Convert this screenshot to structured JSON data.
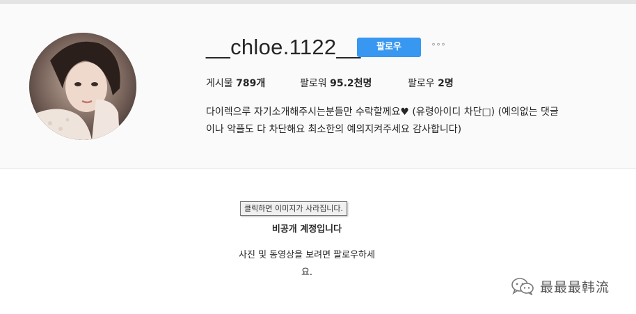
{
  "profile": {
    "username": "__chloe.1122__",
    "follow_label": "팔로우",
    "more_label": "°°°",
    "stats": {
      "posts_label": "게시물",
      "posts_value": "789개",
      "followers_label": "팔로워",
      "followers_value": "95.2천명",
      "following_label": "팔로우",
      "following_value": "2명"
    },
    "bio_line1": "다이렉으루 자기소개해주시는분들만 수락할께요♥ (유령아이디 차단□) (예의없는 댓글",
    "bio_line2": "이나 악플도 다 차단해요 최소한의 예의지켜주세요 감사합니다)"
  },
  "tooltip": "클릭하면 이미지가 사라집니다.",
  "private": {
    "title": "비공개 계정입니다",
    "subtitle_line1": "사진 및 동영상을 보려면 팔로우하세",
    "subtitle_line2": "요."
  },
  "watermark": {
    "icon": "wechat-icon",
    "text": "最最最韩流"
  }
}
